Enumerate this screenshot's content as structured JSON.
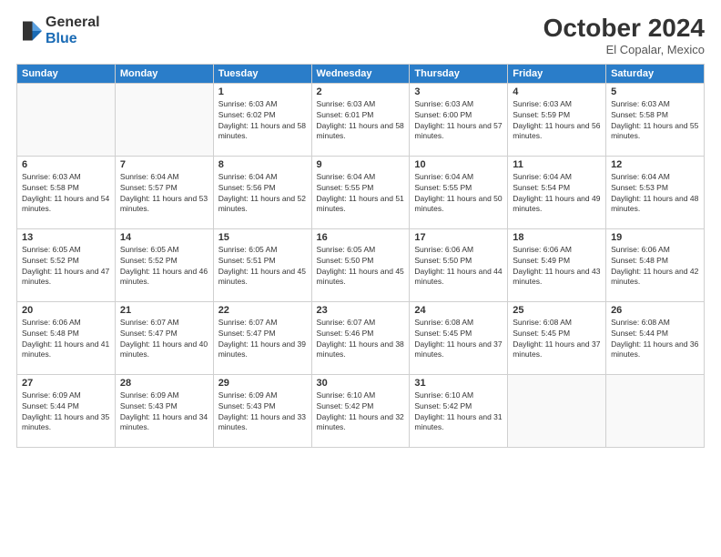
{
  "header": {
    "logo": {
      "general": "General",
      "blue": "Blue"
    },
    "title": "October 2024",
    "location": "El Copalar, Mexico"
  },
  "weekdays": [
    "Sunday",
    "Monday",
    "Tuesday",
    "Wednesday",
    "Thursday",
    "Friday",
    "Saturday"
  ],
  "weeks": [
    [
      {
        "day": "",
        "info": ""
      },
      {
        "day": "",
        "info": ""
      },
      {
        "day": "1",
        "info": "Sunrise: 6:03 AM\nSunset: 6:02 PM\nDaylight: 11 hours and 58 minutes."
      },
      {
        "day": "2",
        "info": "Sunrise: 6:03 AM\nSunset: 6:01 PM\nDaylight: 11 hours and 58 minutes."
      },
      {
        "day": "3",
        "info": "Sunrise: 6:03 AM\nSunset: 6:00 PM\nDaylight: 11 hours and 57 minutes."
      },
      {
        "day": "4",
        "info": "Sunrise: 6:03 AM\nSunset: 5:59 PM\nDaylight: 11 hours and 56 minutes."
      },
      {
        "day": "5",
        "info": "Sunrise: 6:03 AM\nSunset: 5:58 PM\nDaylight: 11 hours and 55 minutes."
      }
    ],
    [
      {
        "day": "6",
        "info": "Sunrise: 6:03 AM\nSunset: 5:58 PM\nDaylight: 11 hours and 54 minutes."
      },
      {
        "day": "7",
        "info": "Sunrise: 6:04 AM\nSunset: 5:57 PM\nDaylight: 11 hours and 53 minutes."
      },
      {
        "day": "8",
        "info": "Sunrise: 6:04 AM\nSunset: 5:56 PM\nDaylight: 11 hours and 52 minutes."
      },
      {
        "day": "9",
        "info": "Sunrise: 6:04 AM\nSunset: 5:55 PM\nDaylight: 11 hours and 51 minutes."
      },
      {
        "day": "10",
        "info": "Sunrise: 6:04 AM\nSunset: 5:55 PM\nDaylight: 11 hours and 50 minutes."
      },
      {
        "day": "11",
        "info": "Sunrise: 6:04 AM\nSunset: 5:54 PM\nDaylight: 11 hours and 49 minutes."
      },
      {
        "day": "12",
        "info": "Sunrise: 6:04 AM\nSunset: 5:53 PM\nDaylight: 11 hours and 48 minutes."
      }
    ],
    [
      {
        "day": "13",
        "info": "Sunrise: 6:05 AM\nSunset: 5:52 PM\nDaylight: 11 hours and 47 minutes."
      },
      {
        "day": "14",
        "info": "Sunrise: 6:05 AM\nSunset: 5:52 PM\nDaylight: 11 hours and 46 minutes."
      },
      {
        "day": "15",
        "info": "Sunrise: 6:05 AM\nSunset: 5:51 PM\nDaylight: 11 hours and 45 minutes."
      },
      {
        "day": "16",
        "info": "Sunrise: 6:05 AM\nSunset: 5:50 PM\nDaylight: 11 hours and 45 minutes."
      },
      {
        "day": "17",
        "info": "Sunrise: 6:06 AM\nSunset: 5:50 PM\nDaylight: 11 hours and 44 minutes."
      },
      {
        "day": "18",
        "info": "Sunrise: 6:06 AM\nSunset: 5:49 PM\nDaylight: 11 hours and 43 minutes."
      },
      {
        "day": "19",
        "info": "Sunrise: 6:06 AM\nSunset: 5:48 PM\nDaylight: 11 hours and 42 minutes."
      }
    ],
    [
      {
        "day": "20",
        "info": "Sunrise: 6:06 AM\nSunset: 5:48 PM\nDaylight: 11 hours and 41 minutes."
      },
      {
        "day": "21",
        "info": "Sunrise: 6:07 AM\nSunset: 5:47 PM\nDaylight: 11 hours and 40 minutes."
      },
      {
        "day": "22",
        "info": "Sunrise: 6:07 AM\nSunset: 5:47 PM\nDaylight: 11 hours and 39 minutes."
      },
      {
        "day": "23",
        "info": "Sunrise: 6:07 AM\nSunset: 5:46 PM\nDaylight: 11 hours and 38 minutes."
      },
      {
        "day": "24",
        "info": "Sunrise: 6:08 AM\nSunset: 5:45 PM\nDaylight: 11 hours and 37 minutes."
      },
      {
        "day": "25",
        "info": "Sunrise: 6:08 AM\nSunset: 5:45 PM\nDaylight: 11 hours and 37 minutes."
      },
      {
        "day": "26",
        "info": "Sunrise: 6:08 AM\nSunset: 5:44 PM\nDaylight: 11 hours and 36 minutes."
      }
    ],
    [
      {
        "day": "27",
        "info": "Sunrise: 6:09 AM\nSunset: 5:44 PM\nDaylight: 11 hours and 35 minutes."
      },
      {
        "day": "28",
        "info": "Sunrise: 6:09 AM\nSunset: 5:43 PM\nDaylight: 11 hours and 34 minutes."
      },
      {
        "day": "29",
        "info": "Sunrise: 6:09 AM\nSunset: 5:43 PM\nDaylight: 11 hours and 33 minutes."
      },
      {
        "day": "30",
        "info": "Sunrise: 6:10 AM\nSunset: 5:42 PM\nDaylight: 11 hours and 32 minutes."
      },
      {
        "day": "31",
        "info": "Sunrise: 6:10 AM\nSunset: 5:42 PM\nDaylight: 11 hours and 31 minutes."
      },
      {
        "day": "",
        "info": ""
      },
      {
        "day": "",
        "info": ""
      }
    ]
  ]
}
